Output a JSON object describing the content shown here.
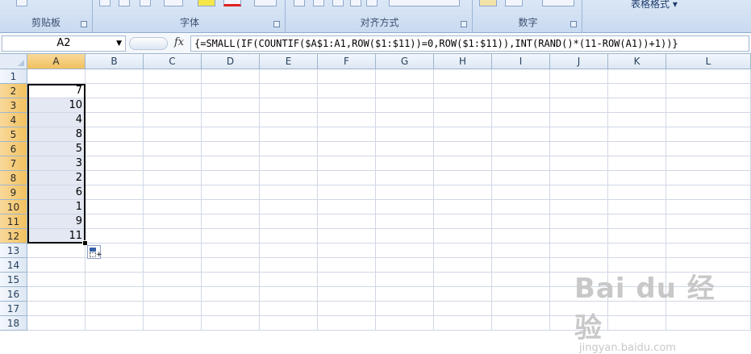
{
  "ribbon": {
    "groups": [
      {
        "label": "剪贴板"
      },
      {
        "label": "字体"
      },
      {
        "label": "对齐方式"
      },
      {
        "label": "数字"
      },
      {
        "label": "表格格式"
      }
    ]
  },
  "formula_bar": {
    "name_box": "A2",
    "fx": "fx",
    "formula": "{=SMALL(IF(COUNTIF($A$1:A1,ROW($1:$11))=0,ROW($1:$11)),INT(RAND()*(11-ROW(A1))+1))}"
  },
  "columns": [
    "A",
    "B",
    "C",
    "D",
    "E",
    "F",
    "G",
    "H",
    "I",
    "J",
    "K",
    "L"
  ],
  "rows": [
    "1",
    "2",
    "3",
    "4",
    "5",
    "6",
    "7",
    "8",
    "9",
    "10",
    "11",
    "12",
    "13",
    "14",
    "15",
    "16",
    "17",
    "18"
  ],
  "column_a_values": [
    "",
    "7",
    "10",
    "4",
    "8",
    "5",
    "3",
    "2",
    "6",
    "1",
    "9",
    "11"
  ],
  "watermark": {
    "big": "Bai du 经验",
    "small": "jingyan.baidu.com"
  }
}
